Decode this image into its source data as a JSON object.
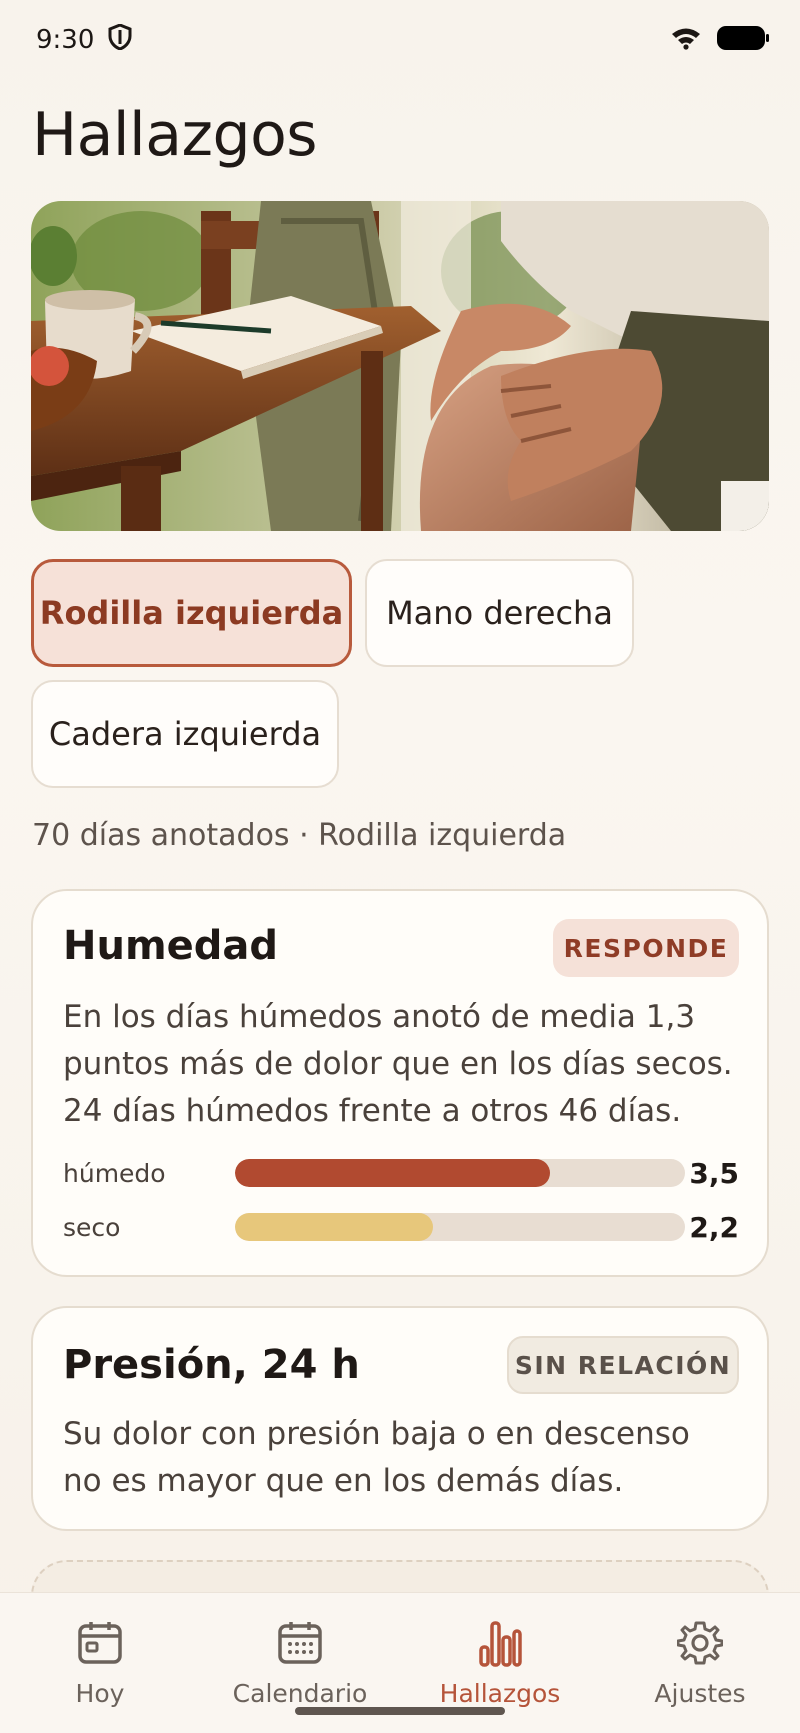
{
  "status_bar": {
    "time": "9:30"
  },
  "page": {
    "title": "Hallazgos"
  },
  "chips": [
    {
      "label": "Rodilla izquierda",
      "active": true
    },
    {
      "label": "Mano derecha",
      "active": false
    },
    {
      "label": "Cadera izquierda",
      "active": false
    }
  ],
  "summary": "70 días anotados · Rodilla izquierda",
  "cards": {
    "humidity": {
      "title": "Humedad",
      "badge": "RESPONDE",
      "text": "En los días húmedos anotó de media 1,3 puntos más de dolor que en los días secos. 24 días húmedos frente a otros 46 días.",
      "bars": [
        {
          "label": "húmedo",
          "value": "3,5",
          "fraction": 0.7,
          "color": "#b14a30"
        },
        {
          "label": "seco",
          "value": "2,2",
          "fraction": 0.44,
          "color": "#e7c77b"
        }
      ]
    },
    "pressure": {
      "title": "Presión, 24 h",
      "badge": "SIN RELACIÓN",
      "text": "Su dolor con presión baja o en descenso no es mayor que en los demás días."
    }
  },
  "nav": [
    {
      "label": "Hoy",
      "icon": "calendar-day-icon",
      "active": false
    },
    {
      "label": "Calendario",
      "icon": "calendar-grid-icon",
      "active": false
    },
    {
      "label": "Hallazgos",
      "icon": "bar-chart-icon",
      "active": true
    },
    {
      "label": "Ajustes",
      "icon": "gear-icon",
      "active": false
    }
  ],
  "colors": {
    "accent": "#b5543a",
    "background": "#f8f3ec"
  }
}
